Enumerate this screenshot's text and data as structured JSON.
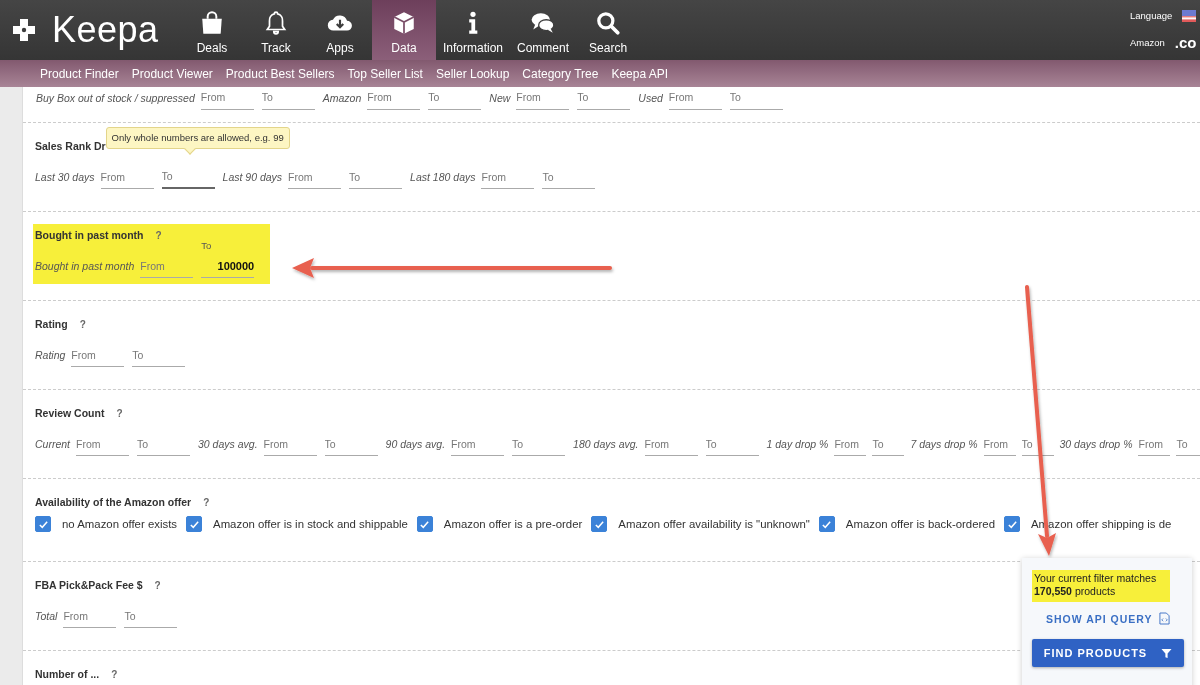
{
  "header": {
    "logo": "Keepa",
    "nav": [
      {
        "label": "Deals",
        "kind": "bag",
        "selected": false
      },
      {
        "label": "Track",
        "kind": "bell",
        "selected": false
      },
      {
        "label": "Apps",
        "kind": "cloud",
        "selected": false
      },
      {
        "label": "Data",
        "kind": "cube",
        "selected": true
      },
      {
        "label": "Information",
        "kind": "info",
        "selected": false
      },
      {
        "label": "Comment",
        "kind": "chat",
        "selected": false
      },
      {
        "label": "Search",
        "kind": "search",
        "selected": false
      }
    ],
    "language_label": "Language",
    "marketplace_label": "Amazon",
    "marketplace_value": ".co"
  },
  "subnav": [
    "Product Finder",
    "Product Viewer",
    "Product Best Sellers",
    "Top Seller List",
    "Seller Lookup",
    "Category Tree",
    "Keepa API"
  ],
  "top_row": [
    {
      "label": "Buy Box out of stock / suppressed",
      "fields": [
        {
          "placeholder": "From",
          "focused": false
        },
        {
          "placeholder": "To",
          "focused": false
        }
      ]
    },
    {
      "label": "Amazon",
      "fields": [
        {
          "placeholder": "From",
          "focused": false
        },
        {
          "placeholder": "To",
          "focused": false
        }
      ]
    },
    {
      "label": "New",
      "fields": [
        {
          "placeholder": "From",
          "focused": false
        },
        {
          "placeholder": "To",
          "focused": false
        }
      ]
    },
    {
      "label": "Used",
      "fields": [
        {
          "placeholder": "From",
          "focused": false
        },
        {
          "placeholder": "To",
          "focused": false
        }
      ]
    }
  ],
  "sections": [
    {
      "kind": "range",
      "title": "Sales Rank Dr",
      "highlighted": false,
      "groups": [
        {
          "label": "Last 30 days",
          "kind": "wide",
          "fields": [
            {
              "placeholder": "From",
              "focused": false
            },
            {
              "placeholder": "To",
              "focused": true,
              "tooltip": "Only whole numbers are allowed, e.g. 99"
            }
          ]
        },
        {
          "label": "Last 90 days",
          "kind": "wide",
          "fields": [
            {
              "placeholder": "From",
              "focused": false
            },
            {
              "placeholder": "To",
              "focused": false
            }
          ]
        },
        {
          "label": "Last 180 days",
          "kind": "wide",
          "fields": [
            {
              "placeholder": "From",
              "focused": false
            },
            {
              "placeholder": "To",
              "focused": false
            }
          ]
        }
      ]
    },
    {
      "kind": "range",
      "title": "Bought in past month",
      "help": "?",
      "highlighted": true,
      "groups": [
        {
          "label": "Bought in past month",
          "kind": "wide",
          "fields": [
            {
              "placeholder": "From",
              "focused": false
            },
            {
              "placeholder": "To",
              "value": "100000",
              "focused": false
            }
          ]
        }
      ]
    },
    {
      "kind": "range",
      "title": "Rating",
      "help": "?",
      "highlighted": false,
      "groups": [
        {
          "label": "Rating",
          "kind": "wide",
          "fields": [
            {
              "placeholder": "From",
              "focused": false
            },
            {
              "placeholder": "To",
              "focused": false
            }
          ]
        }
      ]
    },
    {
      "kind": "range",
      "title": "Review Count",
      "help": "?",
      "highlighted": false,
      "groups": [
        {
          "label": "Current",
          "kind": "wide",
          "fields": [
            {
              "placeholder": "From",
              "focused": false
            },
            {
              "placeholder": "To",
              "focused": false
            }
          ]
        },
        {
          "label": "30 days avg.",
          "kind": "wide",
          "fields": [
            {
              "placeholder": "From",
              "focused": false
            },
            {
              "placeholder": "To",
              "focused": false
            }
          ]
        },
        {
          "label": "90 days avg.",
          "kind": "wide",
          "fields": [
            {
              "placeholder": "From",
              "focused": false
            },
            {
              "placeholder": "To",
              "focused": false
            }
          ]
        },
        {
          "label": "180 days avg.",
          "kind": "wide",
          "fields": [
            {
              "placeholder": "From",
              "focused": false
            },
            {
              "placeholder": "To",
              "focused": false
            }
          ]
        },
        {
          "label": "1 day drop %",
          "kind": "narrow",
          "fields": [
            {
              "placeholder": "From",
              "focused": false
            },
            {
              "placeholder": "To",
              "focused": false
            }
          ]
        },
        {
          "label": "7 days drop %",
          "kind": "narrow",
          "fields": [
            {
              "placeholder": "From",
              "focused": false
            },
            {
              "placeholder": "To",
              "focused": false
            }
          ]
        },
        {
          "label": "30 days drop %",
          "kind": "narrow",
          "fields": [
            {
              "placeholder": "From",
              "focused": false
            },
            {
              "placeholder": "To",
              "focused": false
            }
          ]
        }
      ]
    },
    {
      "kind": "checks",
      "title": "Availability of the Amazon offer",
      "help": "?",
      "highlighted": false,
      "options": [
        {
          "label": "no Amazon offer exists",
          "checked": true
        },
        {
          "label": "Amazon offer is in stock and shippable",
          "checked": true
        },
        {
          "label": "Amazon offer is a pre-order",
          "checked": true
        },
        {
          "label": "Amazon offer availability is \"unknown\"",
          "checked": true
        },
        {
          "label": "Amazon offer is back-ordered",
          "checked": true
        },
        {
          "label": "Amazon offer shipping is de",
          "checked": true
        }
      ]
    },
    {
      "kind": "range",
      "title": "FBA Pick&Pack Fee $",
      "help": "?",
      "highlighted": false,
      "groups": [
        {
          "label": "Total",
          "kind": "wide",
          "fields": [
            {
              "placeholder": "From",
              "focused": false
            },
            {
              "placeholder": "To",
              "focused": false
            }
          ]
        }
      ]
    },
    {
      "kind": "range",
      "title": "Number of ...",
      "help": "?",
      "highlighted": false
    }
  ],
  "result_panel": {
    "match_text": "Your current filter matches **170,550** products",
    "highlighted": true,
    "api_link": "SHOW API QUERY",
    "find_button": "FIND PRODUCTS"
  }
}
